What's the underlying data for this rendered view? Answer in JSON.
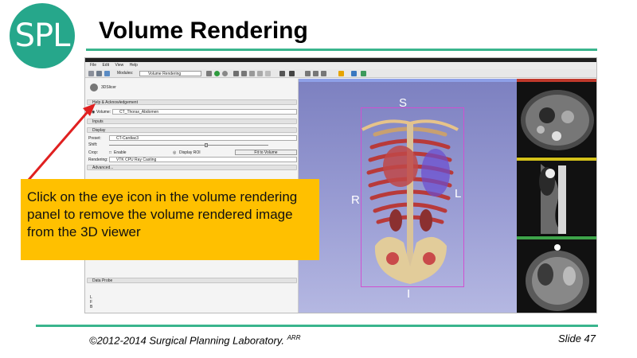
{
  "logo": {
    "text": "SPL"
  },
  "slide": {
    "title": "Volume Rendering",
    "footer_copyright": "©2012-2014 Surgical Planning Laboratory.",
    "footer_copyright_suffix": "ARR",
    "footer_slide": "Slide 47"
  },
  "callout": {
    "text": "Click on the eye icon in the volume rendering panel to remove the volume rendered image from the 3D viewer"
  },
  "app": {
    "menu": [
      "File",
      "Edit",
      "View",
      "Help"
    ],
    "modules_label": "Modules:",
    "module_selected": "Volume Rendering",
    "brand": "3DSlicer",
    "help_section": "Help & Acknowledgement",
    "volume_label": "Volume:",
    "volume_value": "CT_Thorax_Abdomen",
    "inputs_section": "Inputs",
    "display_section": "Display",
    "preset_label": "Preset:",
    "preset_value": "CT-Cardiac3",
    "shift_label": "Shift:",
    "crop_label": "Crop:",
    "enable_label": "Enable",
    "display_roi_label": "Display ROI",
    "fit_button": "Fit to Volume",
    "rendering_label": "Rendering:",
    "rendering_value": "VTK CPU Ray Casting",
    "advanced_section": "Advanced...",
    "data_probe_section": "Data Probe",
    "position_letters": [
      "L",
      "F",
      "B"
    ]
  },
  "view3d": {
    "orient_s": "S",
    "orient_r": "R",
    "orient_l": "L",
    "orient_i": "I"
  },
  "colors": {
    "accent": "#3ab58d",
    "callout": "#ffc000",
    "red_slice_bar": "#c0392b",
    "yellow_slice_bar": "#d4c21a",
    "green_slice_bar": "#3ea34a"
  }
}
